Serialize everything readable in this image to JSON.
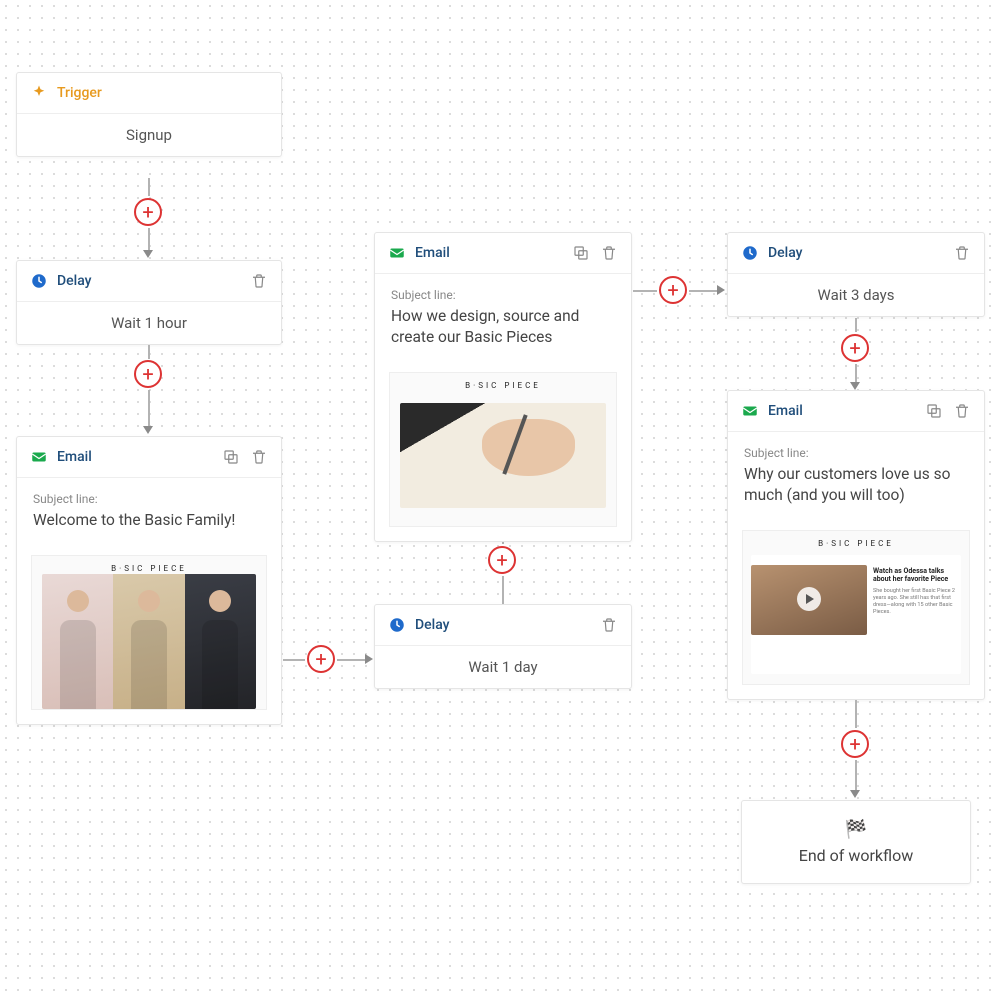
{
  "nodes": {
    "trigger": {
      "type_label": "Trigger",
      "body": "Signup"
    },
    "delay1": {
      "type_label": "Delay",
      "body": "Wait 1 hour"
    },
    "email1": {
      "type_label": "Email",
      "subject_label": "Subject line:",
      "subject": "Welcome to the Basic Family!",
      "brand": "B·SIC PIECE"
    },
    "delay2": {
      "type_label": "Delay",
      "body": "Wait 1 day"
    },
    "email2": {
      "type_label": "Email",
      "subject_label": "Subject line:",
      "subject": "How we design, source and create our Basic Pieces",
      "brand": "B·SIC PIECE"
    },
    "delay3": {
      "type_label": "Delay",
      "body": "Wait 3 days"
    },
    "email3": {
      "type_label": "Email",
      "subject_label": "Subject line:",
      "subject": "Why our customers love us so much (and you will too)",
      "brand": "B·SIC PIECE",
      "testimonial_heading": "Watch as Odessa talks about her favorite Piece",
      "testimonial_body": "She bought her first Basic Piece 2 years ago. She still has that first dress—along with 15 other Basic Pieces."
    },
    "end": {
      "label": "End of workflow"
    }
  },
  "icons": {
    "trigger": "spark-icon",
    "delay": "clock-icon",
    "email": "mail-icon",
    "copy": "copy-icon",
    "trash": "trash-icon",
    "flag": "flag-icon",
    "plus": "+"
  },
  "colors": {
    "trigger_accent": "#e79a1f",
    "delay_accent": "#1f6acb",
    "email_accent": "#1aa94d",
    "connector": "#b3b3b3",
    "plus_border": "#d33"
  }
}
